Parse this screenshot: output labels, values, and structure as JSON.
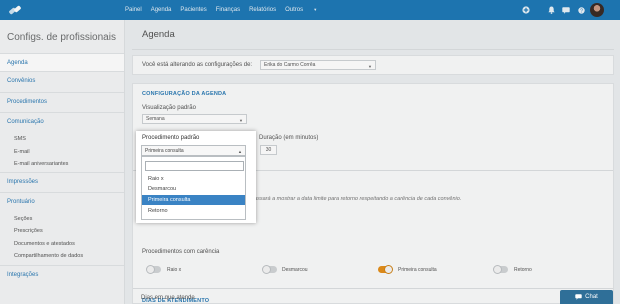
{
  "nav": {
    "items": [
      {
        "label": "Painel"
      },
      {
        "label": "Agenda"
      },
      {
        "label": "Pacientes"
      },
      {
        "label": "Finanças"
      },
      {
        "label": "Relatórios"
      },
      {
        "label": "Outros"
      }
    ],
    "more_caret": "▾"
  },
  "sidebar": {
    "title": "Configs. de profissionais",
    "items": [
      {
        "label": "Agenda",
        "active": true
      },
      {
        "label": "Convênios"
      },
      {
        "label": "Procedimentos"
      },
      {
        "label": "Comunicação"
      },
      {
        "label": "Impressões"
      },
      {
        "label": "Prontuário"
      },
      {
        "label": "Integrações"
      }
    ],
    "comunicacao_sub": [
      {
        "label": "SMS"
      },
      {
        "label": "E-mail"
      },
      {
        "label": "E-mail aniversariantes"
      }
    ],
    "prontuario_sub": [
      {
        "label": "Seções"
      },
      {
        "label": "Prescrições"
      },
      {
        "label": "Documentos e atestados"
      },
      {
        "label": "Compartilhamento de dados"
      }
    ]
  },
  "main": {
    "title": "Agenda",
    "altering_label": "Você está alterando as configurações de:",
    "professional_value": "Erika do Carmo Corrêa",
    "config_section": "CONFIGURAÇÃO DA AGENDA",
    "default_view_label": "Visualização padrão",
    "default_view_value": "Semana",
    "duration_label": "Duração (em minutos)",
    "duration_value": "30",
    "help_visible_text": "passará a mostrar a data limite para retorno respeitando a carência de cada convênio.",
    "help_prefix": "a",
    "carencia_label": "Procedimentos com carência",
    "toggles": [
      {
        "label": "Raio x",
        "on": false
      },
      {
        "label": "Desmarcou",
        "on": false
      },
      {
        "label": "Primeira consulta",
        "on": true
      },
      {
        "label": "Retorno",
        "on": false
      }
    ],
    "dias_section": "DIAS DE ATENDIMENTO",
    "dias_label": "Dias em que atende"
  },
  "popup": {
    "label": "Procedimento padrão",
    "selected": "Primeira consulta",
    "search_placeholder": "",
    "options": [
      {
        "label": "Raio x",
        "selected": false
      },
      {
        "label": "Desmarcou",
        "selected": false
      },
      {
        "label": "Primeira consulta",
        "selected": true
      },
      {
        "label": "Retorno",
        "selected": false
      }
    ]
  },
  "chat": {
    "label": "Chat"
  },
  "colors": {
    "topbar": "#1f79b7",
    "accent": "#2c7bb5",
    "toggle_on": "#e48f1b",
    "option_selected": "#3a83c4"
  }
}
